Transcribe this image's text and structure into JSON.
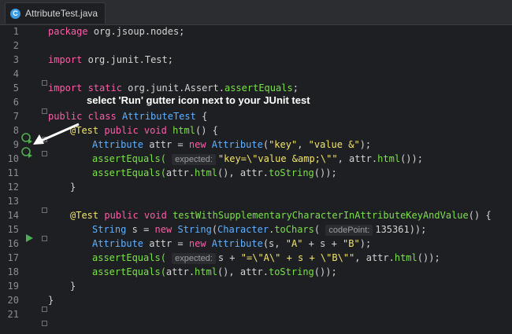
{
  "tab": {
    "icon_letter": "C",
    "label": "AttributeTest.java"
  },
  "callout": "select 'Run' gutter icon next to your JUnit test",
  "lines": [
    {
      "n": "1"
    },
    {
      "n": "2"
    },
    {
      "n": "3"
    },
    {
      "n": "4"
    },
    {
      "n": "5"
    },
    {
      "n": "6"
    },
    {
      "n": "7"
    },
    {
      "n": "8"
    },
    {
      "n": "9"
    },
    {
      "n": "10"
    },
    {
      "n": "11"
    },
    {
      "n": "12"
    },
    {
      "n": "13"
    },
    {
      "n": "14"
    },
    {
      "n": "15"
    },
    {
      "n": "16"
    },
    {
      "n": "17"
    },
    {
      "n": "18"
    },
    {
      "n": "19"
    },
    {
      "n": "20"
    },
    {
      "n": "21"
    }
  ],
  "code": {
    "l1": {
      "kw": "package",
      "rest": "org.jsoup.nodes;"
    },
    "l3": {
      "kw": "import",
      "rest": "org.junit.Test;"
    },
    "l5": {
      "kw": "import static",
      "rest": "org.junit.Assert.",
      "fn": "assertEquals",
      ";": ";"
    },
    "l7": {
      "kw": "public class",
      "cls": "AttributeTest",
      "rest": "{"
    },
    "l8": {
      "ann": "@Test",
      "kw": "public void",
      "fn": "html",
      "rest": "() {"
    },
    "l9": {
      "cls": "Attribute",
      "var": "attr",
      "op": "=",
      "kw": "new",
      "cls2": "Attribute",
      "p1": "(",
      "s1": "\"key\"",
      "c": ",",
      "s2": "\"value &\"",
      "end": ");"
    },
    "l10": {
      "fn": "assertEquals(",
      "hint": "expected:",
      "s": "\"key=\\\"value &amp;\\\"\"",
      "rest": ", attr.",
      "fn2": "html",
      "end": "());"
    },
    "l11": {
      "fn": "assertEquals(",
      "rest": "attr.",
      "fn2": "html",
      "mid": "(), attr.",
      "fn3": "toString",
      "end": "());"
    },
    "l12": {
      "rest": "}"
    },
    "l14": {
      "ann": "@Test",
      "kw": "public void",
      "fn": "testWithSupplementaryCharacterInAttributeKeyAndValue",
      "rest": "() {"
    },
    "l15": {
      "cls": "String",
      "var": "s",
      "op": "=",
      "kw": "new",
      "cls2": "String",
      "p": "(",
      "cls3": "Character",
      "dot": ".",
      "fn": "toChars",
      "p2": "(",
      "hint": "codePoint:",
      "num": "135361",
      "end": "));"
    },
    "l16": {
      "cls": "Attribute",
      "var": "attr",
      "op": "=",
      "kw": "new",
      "cls2": "Attribute",
      "p": "(s,",
      "s1": "\"A\"",
      "plus": "+ s +",
      "s2": "\"B\"",
      "end": ");"
    },
    "l17": {
      "fn": "assertEquals(",
      "hint": "expected:",
      "pre": "s +",
      "s1": "\"=\\\"A\\\" + s + \\\"B\\\"\"",
      "rest": ", attr.",
      "fn2": "html",
      "end": "());"
    },
    "l18": {
      "fn": "assertEquals(",
      "rest": "attr.",
      "fn2": "html",
      "mid": "(), attr.",
      "fn3": "toString",
      "end": "());"
    },
    "l19": {
      "rest": "}"
    },
    "l20": {
      "rest": "}"
    }
  },
  "colors": {
    "keyword": "#ff5ca8",
    "class": "#5fb0ff",
    "function": "#7ce04d",
    "string": "#f2e56b",
    "run_icon": "#4caf50"
  }
}
